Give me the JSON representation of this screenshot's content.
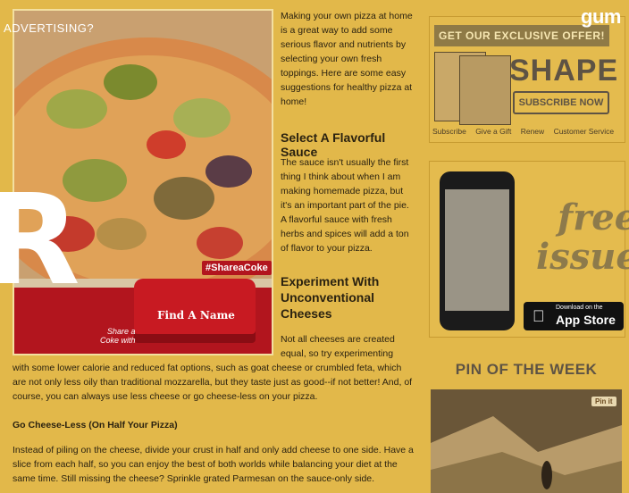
{
  "top_bar": {
    "advertising_label": "ADVERTISING?",
    "gum_logo": "gum"
  },
  "hero_image": {
    "coke_hashtag": "#ShareaCoke",
    "coke_button": "Find A Name",
    "coke_tagline": "Share a\nCoke with"
  },
  "article": {
    "intro": "Making your own pizza at home is a great way to add some serious flavor and nutrients by selecting your own fresh toppings. Here are some easy suggestions for healthy pizza at home!",
    "section1_heading": "Select A Flavorful Sauce",
    "section1_body": "The sauce isn't usually the first thing I think about when I am making homemade pizza, but it's an important part of the pie. A flavorful sauce with fresh herbs and spices will add a ton of flavor to your pizza.",
    "section2_heading": "Experiment With Unconventional Cheeses",
    "section2_body_start": "Not all cheeses are created equal, so try experimenting",
    "section2_body_rest": "with some lower calorie and reduced fat options, such as goat cheese or crumbled feta, which are not only less oily than traditional mozzarella, but they taste just as good--if not better! And, of course, you can always use less cheese or go cheese-less on your pizza.",
    "section3_heading": "Go Cheese-Less (On Half Your Pizza)",
    "section3_body": "Instead of piling on the cheese, divide your crust in half and only add cheese to one side. Have a slice from each half, so you can enjoy the best of both worlds while balancing your diet at the same time. Still missing the cheese? Sprinkle grated Parmesan on the sauce-only side."
  },
  "sidebar": {
    "offer_label": "GET OUR EXCLUSIVE OFFER!",
    "shape_logo": "SHAPE",
    "subscribe_button": "SUBSCRIBE NOW",
    "links": [
      "Subscribe",
      "Give a Gift",
      "Renew",
      "Customer Service"
    ],
    "free_issue_line1": "free",
    "free_issue_line2": "issue!",
    "appstore_small": "Download on the",
    "appstore_big": "App Store",
    "pin_title": "PIN OF THE WEEK",
    "pin_button": "Pin it"
  }
}
